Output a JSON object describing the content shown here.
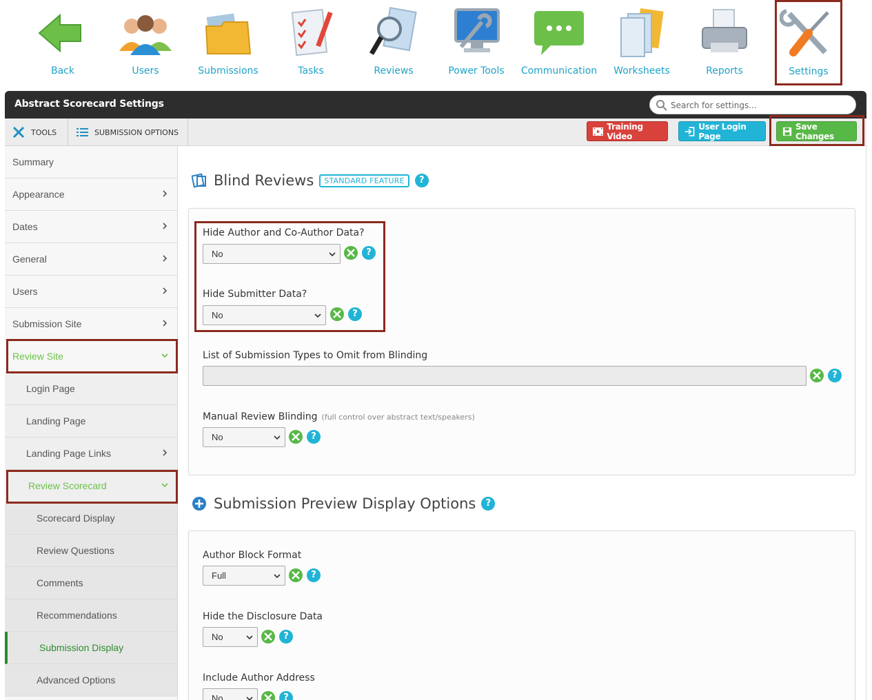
{
  "toolbar": {
    "items": [
      {
        "key": "back",
        "label": "Back",
        "icon": "back-arrow-icon"
      },
      {
        "key": "users",
        "label": "Users",
        "icon": "users-icon"
      },
      {
        "key": "submissions",
        "label": "Submissions",
        "icon": "folder-icon"
      },
      {
        "key": "tasks",
        "label": "Tasks",
        "icon": "checklist-icon"
      },
      {
        "key": "reviews",
        "label": "Reviews",
        "icon": "magnifier-icon"
      },
      {
        "key": "power_tools",
        "label": "Power Tools",
        "icon": "monitor-wrench-icon"
      },
      {
        "key": "communication",
        "label": "Communication",
        "icon": "chat-bubble-icon"
      },
      {
        "key": "worksheets",
        "label": "Worksheets",
        "icon": "documents-icon"
      },
      {
        "key": "reports",
        "label": "Reports",
        "icon": "printer-icon"
      },
      {
        "key": "settings",
        "label": "Settings",
        "icon": "wrench-screwdriver-icon",
        "active": true
      }
    ]
  },
  "header": {
    "title": "Abstract Scorecard Settings",
    "search_placeholder": "Search for settings..."
  },
  "subbar": {
    "tools_label": "TOOLS",
    "submission_options_label": "SUBMISSION OPTIONS",
    "training_video_label": "Training Video",
    "user_login_label": "User Login Page",
    "save_label": "Save Changes"
  },
  "sidebar": {
    "items": [
      {
        "label": "Summary",
        "level": 1
      },
      {
        "label": "Appearance",
        "level": 1,
        "chevron": "right"
      },
      {
        "label": "Dates",
        "level": 1,
        "chevron": "right"
      },
      {
        "label": "General",
        "level": 1,
        "chevron": "right"
      },
      {
        "label": "Users",
        "level": 1,
        "chevron": "right"
      },
      {
        "label": "Submission Site",
        "level": 1,
        "chevron": "right"
      },
      {
        "label": "Review Site",
        "level": 1,
        "chevron": "down",
        "expanded": true
      },
      {
        "label": "Login Page",
        "level": 2
      },
      {
        "label": "Landing Page",
        "level": 2
      },
      {
        "label": "Landing Page Links",
        "level": 2,
        "chevron": "right"
      },
      {
        "label": "Review Scorecard",
        "level": 2,
        "chevron": "down",
        "expanded": true
      },
      {
        "label": "Scorecard Display",
        "level": 3
      },
      {
        "label": "Review Questions",
        "level": 3
      },
      {
        "label": "Comments",
        "level": 3
      },
      {
        "label": "Recommendations",
        "level": 3
      },
      {
        "label": "Submission Display",
        "level": 3,
        "selected": true
      },
      {
        "label": "Advanced Options",
        "level": 3
      }
    ]
  },
  "blind_reviews": {
    "title": "Blind Reviews",
    "badge": "STANDARD FEATURE",
    "fields": {
      "hide_author": {
        "label": "Hide Author and Co-Author Data?",
        "value": "No"
      },
      "hide_submitter": {
        "label": "Hide Submitter Data?",
        "value": "No"
      },
      "omit_types": {
        "label": "List of Submission Types to Omit from Blinding",
        "value": ""
      },
      "manual_blinding": {
        "label": "Manual Review Blinding",
        "note": "(full control over abstract text/speakers)",
        "value": "No"
      }
    }
  },
  "preview_options": {
    "title": "Submission Preview Display Options",
    "fields": {
      "author_block": {
        "label": "Author Block Format",
        "value": "Full"
      },
      "hide_disclosure": {
        "label": "Hide the Disclosure Data",
        "value": "No"
      },
      "include_address": {
        "label": "Include Author Address",
        "value": "No"
      }
    }
  },
  "colors": {
    "accent_cyan": "#21b4d6",
    "accent_green": "#58b847",
    "accent_red": "#d9413b",
    "highlight_outline": "#8b2a1e",
    "header_dark": "#2d2d2d"
  }
}
